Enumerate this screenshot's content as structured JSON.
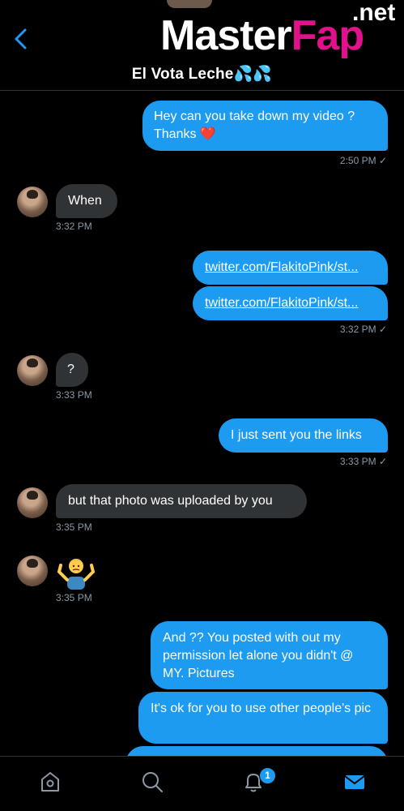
{
  "header": {
    "title": "El Vota Leche💦💦"
  },
  "watermark": {
    "part1": "Master",
    "part2": "Fap",
    "suffix": ".net"
  },
  "messages": [
    {
      "text": "Hey can you take down my video ? Thanks ❤️",
      "time": "2:50 PM ✓"
    },
    {
      "text": "When",
      "time": "3:32 PM"
    },
    {
      "text": "twitter.com/FlakitoPink/st...",
      "time": ""
    },
    {
      "text": "twitter.com/FlakitoPink/st...",
      "time": "3:32 PM ✓"
    },
    {
      "text": "?",
      "time": "3:33 PM"
    },
    {
      "text": "I just sent you the links",
      "time": "3:33 PM ✓"
    },
    {
      "text": "but that photo was uploaded by you",
      "time": "3:35 PM"
    },
    {
      "text": "",
      "time": "3:35 PM"
    },
    {
      "text": "And ?? You posted with out my permission let alone you didn't @ MY. Pictures",
      "time": ""
    },
    {
      "text": "It's ok for you to use other people's pic",
      "time": ""
    }
  ],
  "tabbar": {
    "notifications_badge": "1"
  },
  "colors": {
    "accent": "#1d9bf0",
    "incoming_bubble": "#2f3336",
    "background": "#000000",
    "timestamp": "#8b98a5"
  },
  "icons": [
    "back-chevron-icon",
    "home-icon",
    "search-icon",
    "bell-icon",
    "mail-icon",
    "shrug-emoji"
  ]
}
